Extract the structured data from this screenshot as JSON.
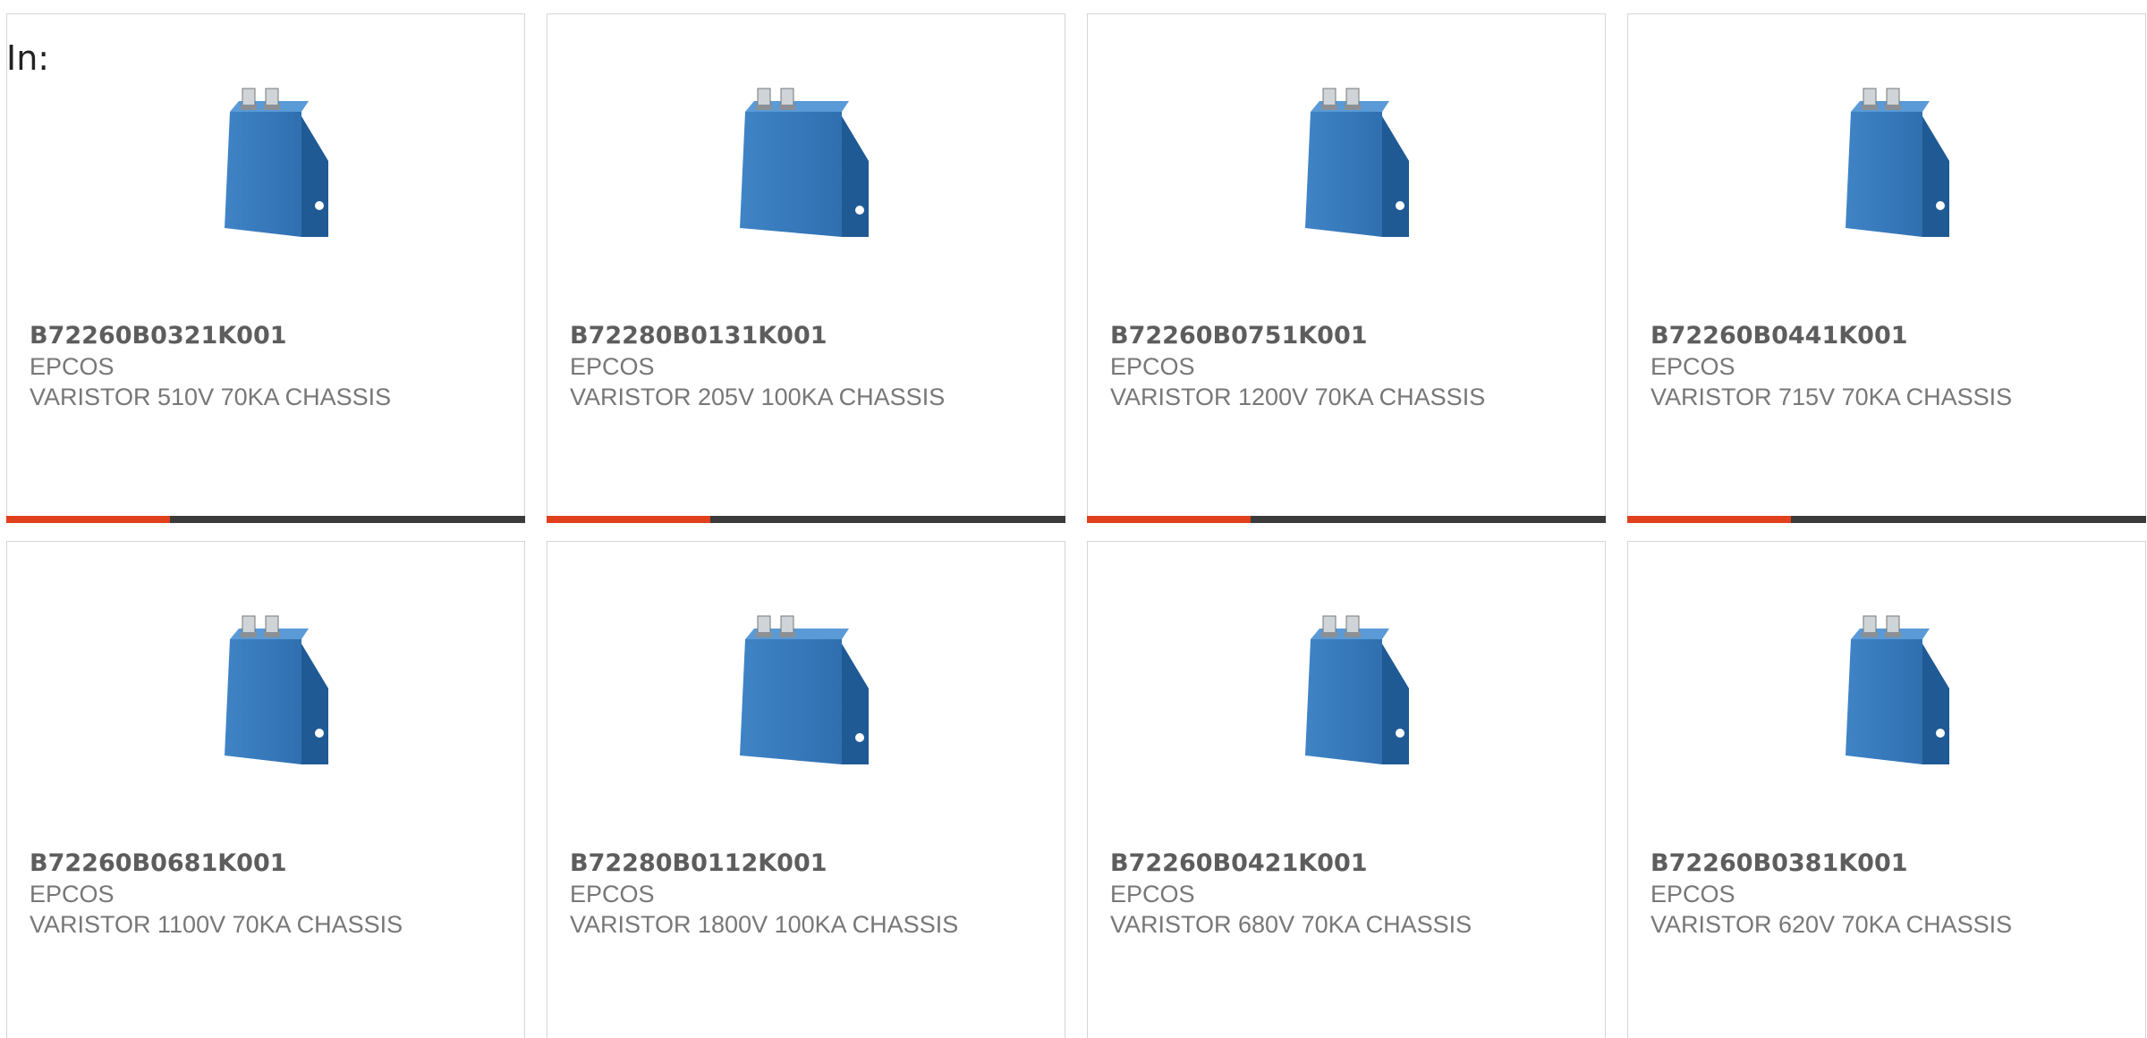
{
  "filter_label": "In:",
  "colors": {
    "accent": "#e0401c",
    "bar": "#3b3b3b",
    "part_number": "#5d5d5d",
    "text": "#777777",
    "border": "#d6d6d6",
    "product_blue": "#2f6fb0"
  },
  "products": [
    {
      "part_number": "B72260B0321K001",
      "manufacturer": "EPCOS",
      "description": "VARISTOR 510V 70KA CHASSIS",
      "image": "varistor-70ka-image"
    },
    {
      "part_number": "B72280B0131K001",
      "manufacturer": "EPCOS",
      "description": "VARISTOR 205V 100KA CHASSIS",
      "image": "varistor-100ka-image"
    },
    {
      "part_number": "B72260B0751K001",
      "manufacturer": "EPCOS",
      "description": "VARISTOR 1200V 70KA CHASSIS",
      "image": "varistor-70ka-image"
    },
    {
      "part_number": "B72260B0441K001",
      "manufacturer": "EPCOS",
      "description": "VARISTOR 715V 70KA CHASSIS",
      "image": "varistor-70ka-image"
    },
    {
      "part_number": "B72260B0681K001",
      "manufacturer": "EPCOS",
      "description": "VARISTOR 1100V 70KA CHASSIS",
      "image": "varistor-70ka-image"
    },
    {
      "part_number": "B72280B0112K001",
      "manufacturer": "EPCOS",
      "description": "VARISTOR 1800V 100KA CHASSIS",
      "image": "varistor-100ka-image"
    },
    {
      "part_number": "B72260B0421K001",
      "manufacturer": "EPCOS",
      "description": "VARISTOR 680V 70KA CHASSIS",
      "image": "varistor-70ka-image"
    },
    {
      "part_number": "B72260B0381K001",
      "manufacturer": "EPCOS",
      "description": "VARISTOR 620V 70KA CHASSIS",
      "image": "varistor-70ka-image"
    }
  ]
}
